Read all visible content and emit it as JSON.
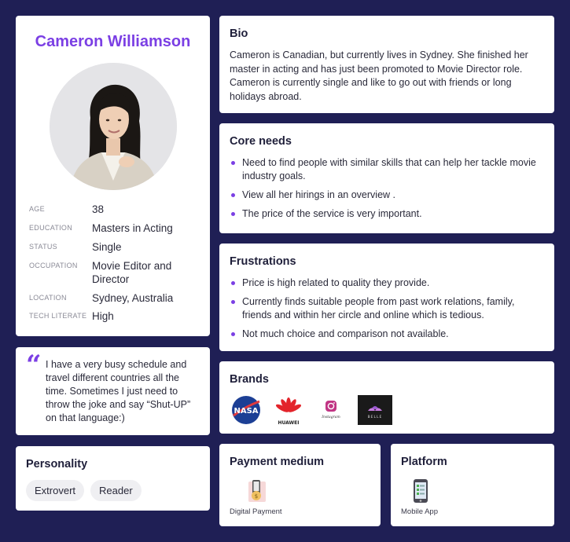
{
  "profile": {
    "name": "Cameron Williamson",
    "details": [
      {
        "label": "AGE",
        "value": "38"
      },
      {
        "label": "EDUCATION",
        "value": "Masters in Acting"
      },
      {
        "label": "STATUS",
        "value": "Single"
      },
      {
        "label": "OCCUPATION",
        "value": "Movie Editor and Director"
      },
      {
        "label": "LOCATION",
        "value": "Sydney, Australia"
      },
      {
        "label": "TECH LITERATE",
        "value": "High"
      }
    ]
  },
  "quote": {
    "text": "I have a very busy schedule and travel different countries all the time. Sometimes I just need to throw the joke and say “Shut-UP” on that language:)"
  },
  "personality": {
    "title": "Personality",
    "traits": [
      "Extrovert",
      "Reader"
    ]
  },
  "bio": {
    "title": "Bio",
    "text": "Cameron is Canadian, but currently lives in Sydney. She finished her master in acting and has just been promoted to Movie Director role. Cameron is currently single and  like to go out with friends or long holidays abroad."
  },
  "core_needs": {
    "title": "Core needs",
    "items": [
      "Need to find people with similar skills that can help her tackle movie industry goals.",
      "View all her hirings in an overview .",
      "The price of the service is very important."
    ]
  },
  "frustrations": {
    "title": "Frustrations",
    "items": [
      "Price is high related to quality they provide.",
      "Currently finds suitable people from past work relations, family, friends and within her circle and online which is tedious.",
      "Not much choice and comparison not available."
    ]
  },
  "brands": {
    "title": "Brands",
    "logos": [
      {
        "icon": "nasa-logo",
        "text": "NASA"
      },
      {
        "icon": "huawei-logo",
        "text": "HUAWEI"
      },
      {
        "icon": "instagram-logo",
        "text": "Instagram"
      },
      {
        "icon": "belle-logo",
        "text": "BELLE"
      }
    ]
  },
  "payment": {
    "title": "Payment medium",
    "icon": "digital-payment-icon",
    "label": "Digital Payment"
  },
  "platform": {
    "title": "Platform",
    "icon": "mobile-app-icon",
    "label": "Mobile App"
  },
  "colors": {
    "background": "#1f1f55",
    "accent": "#7b3fe4",
    "card": "#ffffff"
  }
}
